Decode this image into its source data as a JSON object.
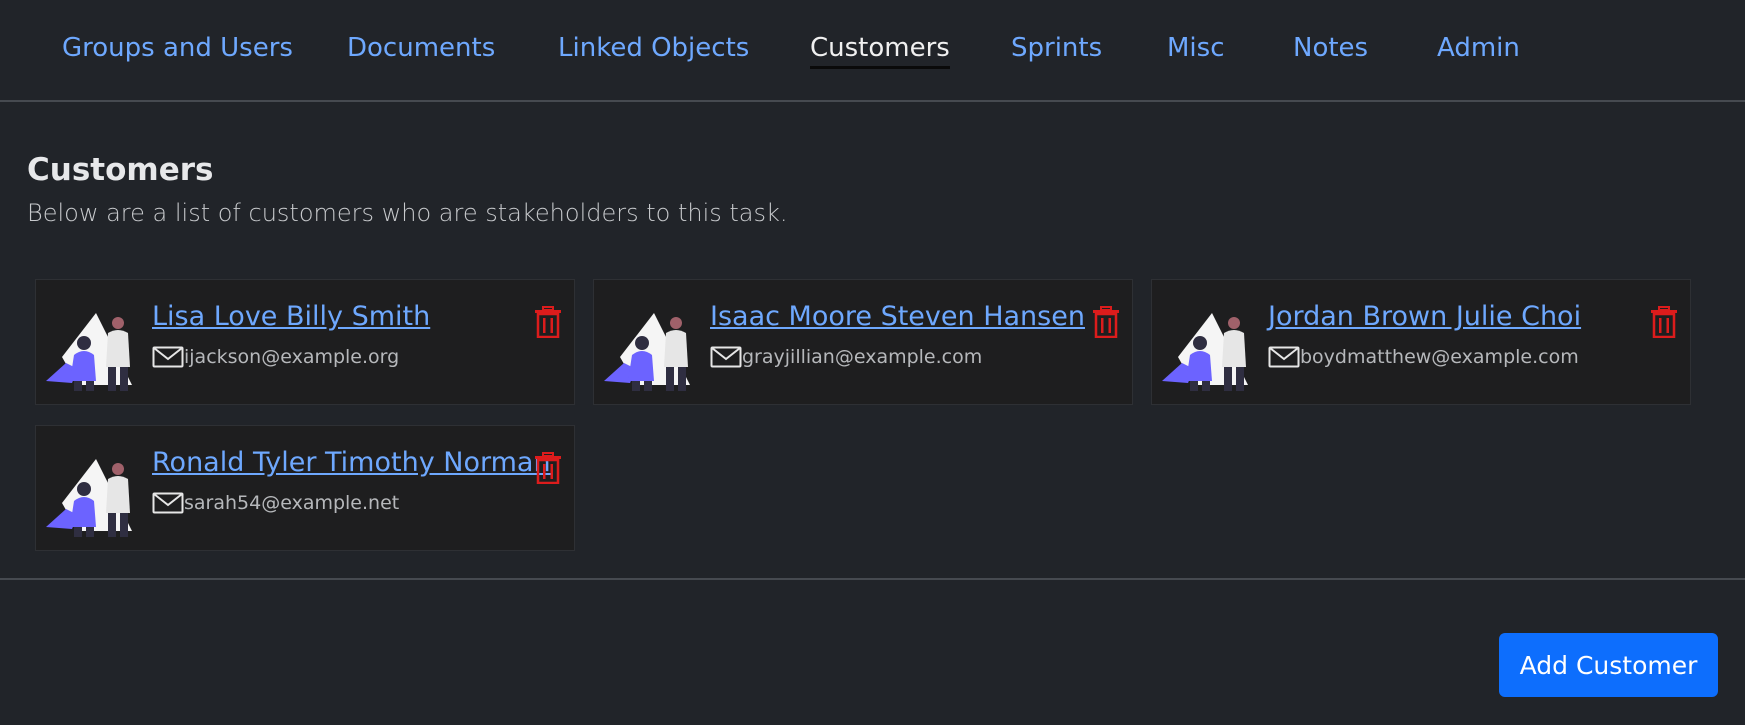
{
  "tabs": [
    {
      "label": "Groups and Users"
    },
    {
      "label": "Documents"
    },
    {
      "label": "Linked Objects"
    },
    {
      "label": "Customers"
    },
    {
      "label": "Sprints"
    },
    {
      "label": "Misc"
    },
    {
      "label": "Notes"
    },
    {
      "label": "Admin"
    }
  ],
  "active_tab": "Customers",
  "section": {
    "title": "Customers",
    "description": "Below are a list of customers who are stakeholders to this task."
  },
  "customers": [
    {
      "name": "Lisa Love Billy Smith",
      "email": "ijackson@example.org"
    },
    {
      "name": "Isaac Moore Steven Hansen",
      "email": "grayjillian@example.com"
    },
    {
      "name": "Jordan Brown Julie Choi",
      "email": "boydmatthew@example.com"
    },
    {
      "name": "Ronald Tyler Timothy Norman",
      "email": "sarah54@example.net"
    }
  ],
  "icons": {
    "mail": "envelope-icon",
    "delete": "trash-icon",
    "avatar": "people-illustration"
  },
  "colors": {
    "link": "#6ea8fe",
    "delete": "#dc1c1c",
    "primary_button": "#0d6efd",
    "background": "#212429"
  },
  "actions": {
    "add_label": "Add Customer"
  }
}
